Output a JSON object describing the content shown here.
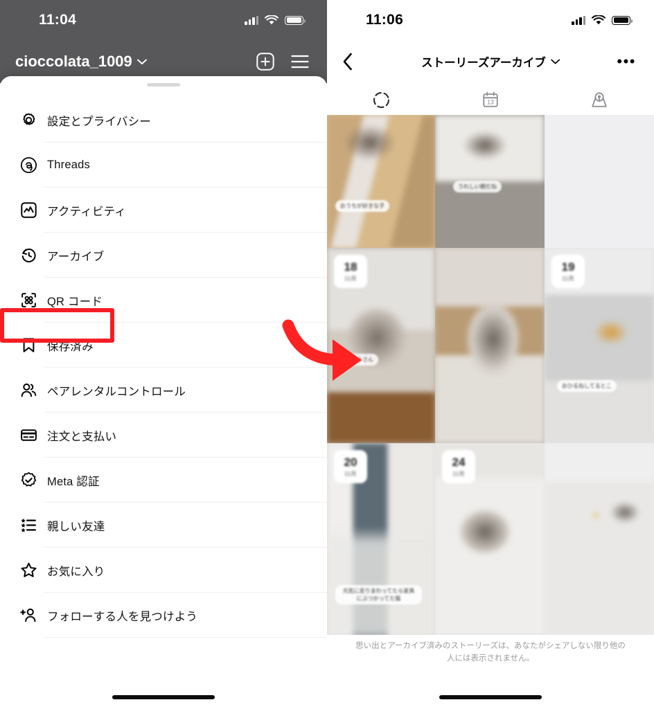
{
  "left": {
    "status": {
      "time": "11:04",
      "signal_icon": "cellular-bars-icon",
      "wifi_icon": "wifi-icon",
      "battery_icon": "battery-icon"
    },
    "header": {
      "username": "cioccolata_1009",
      "chevron_icon": "chevron-down-icon",
      "add_icon": "plus-square-icon",
      "menu_icon": "hamburger-menu-icon"
    },
    "sheet": {
      "grabber": "sheet-grabber",
      "items": [
        {
          "label": "設定とプライバシー",
          "icon": "gear-icon"
        },
        {
          "label": "Threads",
          "icon": "threads-icon"
        },
        {
          "label": "アクティビティ",
          "icon": "activity-chart-icon"
        },
        {
          "label": "アーカイブ",
          "icon": "archive-clock-icon",
          "highlighted": true
        },
        {
          "label": "QR コード",
          "icon": "qr-code-icon"
        },
        {
          "label": "保存済み",
          "icon": "bookmark-icon"
        },
        {
          "label": "ペアレンタルコントロール",
          "icon": "people-icon"
        },
        {
          "label": "注文と支払い",
          "icon": "credit-card-icon"
        },
        {
          "label": "Meta 認証",
          "icon": "verified-badge-icon"
        },
        {
          "label": "親しい友達",
          "icon": "close-friends-list-icon"
        },
        {
          "label": "お気に入り",
          "icon": "star-icon"
        },
        {
          "label": "フォローする人を見つけよう",
          "icon": "add-person-icon"
        }
      ]
    },
    "annotation": {
      "highlight_color": "#f51e25",
      "highlight_target": "アーカイブ"
    },
    "home_indicator": "home-indicator"
  },
  "right": {
    "status": {
      "time": "11:06",
      "signal_icon": "cellular-bars-icon",
      "wifi_icon": "wifi-icon",
      "battery_icon": "battery-icon"
    },
    "nav": {
      "back_icon": "chevron-left-icon",
      "title": "ストーリーズアーカイブ",
      "title_chevron_icon": "chevron-down-icon",
      "more_label": "•••"
    },
    "tabs": [
      {
        "icon": "stories-dashed-circle-icon",
        "name": "stories-archive-tab",
        "selected": true
      },
      {
        "icon": "calendar-icon",
        "name": "calendar-tab",
        "day": "13",
        "selected": false
      },
      {
        "icon": "map-pin-icon",
        "name": "map-tab",
        "selected": false
      }
    ],
    "grid": [
      {
        "date": "",
        "month": "",
        "caption": "おうちが好きな子",
        "bg": "#d7b98e",
        "show_badge": false
      },
      {
        "date": "",
        "month": "",
        "caption": "うれしい朝だね",
        "bg": "#9a9690",
        "show_badge": false
      },
      {
        "date": "",
        "month": "",
        "caption": "",
        "bg": "#efeff1",
        "show_badge": false
      },
      {
        "date": "18",
        "month": "11月",
        "caption": "おはようさん",
        "bg": "#b9ad9e",
        "show_badge": true
      },
      {
        "date": "",
        "month": "",
        "caption": "",
        "bg": "#c6bdb2",
        "show_badge": false
      },
      {
        "date": "19",
        "month": "11月",
        "caption": "おひるねしてるとこ",
        "bg": "#e4e2e2",
        "show_badge": true
      },
      {
        "date": "20",
        "month": "11月",
        "caption": "元気に走りまわってたら家具にぶつかってた猫",
        "bg": "#dcdcdc",
        "show_badge": true
      },
      {
        "date": "24",
        "month": "11月",
        "caption": "",
        "bg": "#e7e5e3",
        "show_badge": true
      },
      {
        "date": "",
        "month": "",
        "caption": "",
        "bg": "#ececec",
        "show_badge": false
      }
    ],
    "footer_note": "思い出とアーカイブ済みのストーリーズは、あなたがシェアしない限り他の人には表示されません。",
    "home_indicator": "home-indicator",
    "annotation": {
      "arrow_color": "#f22",
      "arrow": "curved-red-arrow-pointing-right"
    }
  }
}
